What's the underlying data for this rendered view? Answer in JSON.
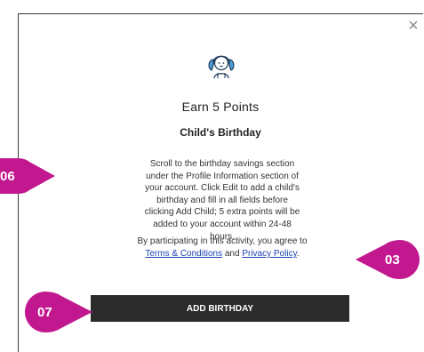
{
  "modal": {
    "close_glyph": "×",
    "icon": "child-avatar-icon",
    "title": "Earn 5 Points",
    "subtitle": "Child's Birthday",
    "description": "Scroll to the birthday savings section under the Profile Information section of your account. Click Edit to add a child's birthday and fill in all fields before clicking Add Child; 5 extra points will be added to your account within 24-48 hours.",
    "consent_prefix": "By participating in this activity, you agree to",
    "terms_link": "Terms & Conditions",
    "consent_and": "and",
    "privacy_link": "Privacy Policy",
    "consent_end": ".",
    "button_label": "ADD BIRTHDAY"
  },
  "callouts": [
    {
      "label": "06",
      "color": "#c2188f"
    },
    {
      "label": "03",
      "color": "#c2188f"
    },
    {
      "label": "07",
      "color": "#c2188f"
    }
  ],
  "colors": {
    "accent": "#c2188f",
    "button": "#2b2b2b",
    "link": "#1a3fb3",
    "icon_blue": "#4a9fd8"
  }
}
